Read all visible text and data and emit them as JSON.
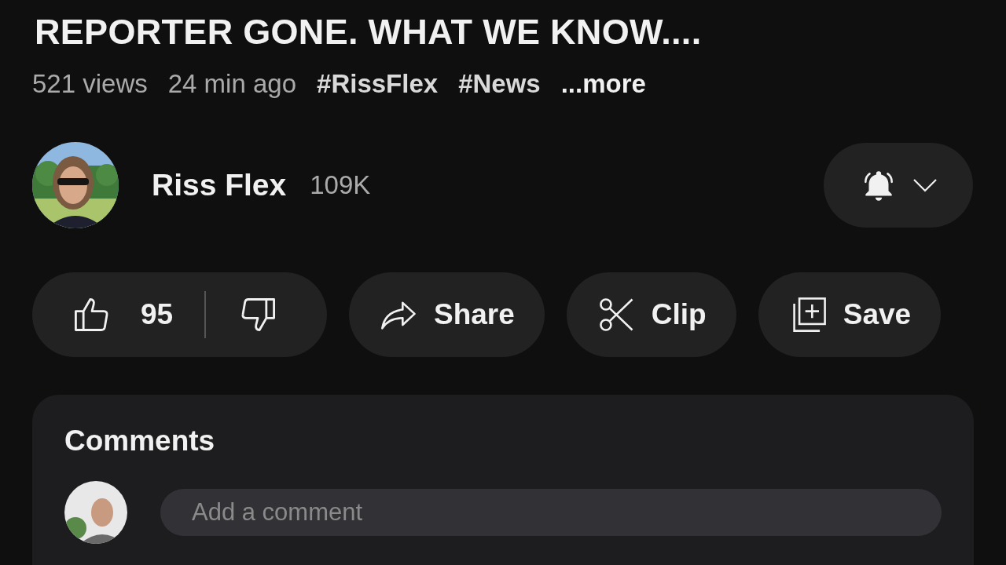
{
  "video": {
    "title": "REPORTER GONE. WHAT WE KNOW....",
    "meta": [
      {
        "kind": "plain",
        "text": "521 views"
      },
      {
        "kind": "plain",
        "text": "24 min ago"
      },
      {
        "kind": "tag",
        "text": "#RissFlex"
      },
      {
        "kind": "tag",
        "text": "#News"
      },
      {
        "kind": "more",
        "text": "...more"
      }
    ]
  },
  "channel": {
    "name": "Riss Flex",
    "subscribers": "109K"
  },
  "actions": [
    {
      "kind": "likes",
      "text": "95"
    },
    {
      "kind": "share",
      "text": "Share"
    },
    {
      "kind": "clip",
      "text": "Clip"
    },
    {
      "kind": "save",
      "text": "Save"
    }
  ],
  "comments": {
    "title": "Comments",
    "placeholder": "Add a comment"
  }
}
